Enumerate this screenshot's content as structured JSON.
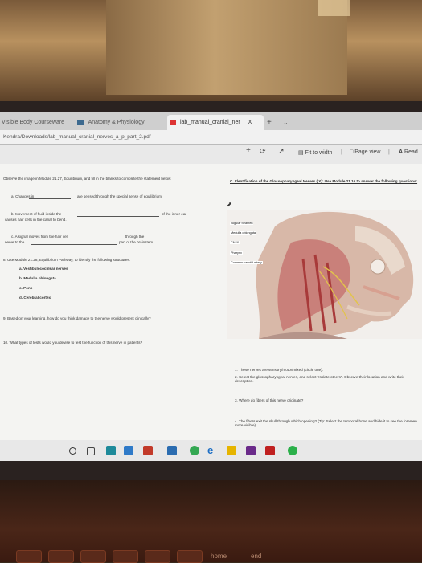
{
  "browser": {
    "tabs": [
      {
        "label": "Visible Body Courseware"
      },
      {
        "label": "Anatomy & Physiology"
      },
      {
        "label": "lab_manual_cranial_ner"
      }
    ],
    "close_tab_label": "X",
    "new_tab_label": "+",
    "address": "Kendra/Downloads/lab_manual_cranial_nerves_a_p_part_2.pdf"
  },
  "pdf_toolbar": {
    "zoom_in": "+",
    "fit_to_width": "Fit to width",
    "page_view": "Page view",
    "read_aloud": "Read"
  },
  "left_column": {
    "instruction": "Observe the image in Module 21.27, Equilibrium, and fill in the blanks to complete the statement below.",
    "items": [
      "a. Changes in",
      "are sensed through the special sense of equilibrium.",
      "b. Movement of fluid inside the",
      "of the inner ear",
      "causes hair cells in the canal to bend.",
      "c. A signal moves from the hair cell",
      "through the",
      "nerve to the",
      "part of the brainstem."
    ],
    "q8": "8. Use Module 21.28, Equilibrium Pathway, to identify the following structures:",
    "structures": [
      "a. Vestibulocochlear nerves",
      "b. Medulla oblongata",
      "c. Pons",
      "d. Cerebral cortex"
    ],
    "q9": "9. Based on your learning, how do you think damage to the nerve would present clinically?",
    "q10": "10. What types of tests would you devise to test the function of this nerve in patients?"
  },
  "right_column": {
    "heading": "C. Identification of the Glossopharyngeal Nerves (IX): Use Module 21.16 to answer the following questions:",
    "figure_labels": [
      "Jugular foramen",
      "Medulla oblongata",
      "CN IX",
      "Pharynx",
      "Common carotid artery"
    ],
    "q1": "1. These nerves are sensory/motor/mixed (circle one).",
    "q2": "2. Select the glossopharyngeal nerves, and select \"Isolate others\". Observe their location and write their description.",
    "q3": "3. Where do fibers of this nerve originate?",
    "q4": "4. The fibers exit the skull through which opening? (Tip: Select the temporal bone and hide it to see the foramen more visible)"
  },
  "keyboard": {
    "home_key": "home",
    "end_key": "end"
  }
}
